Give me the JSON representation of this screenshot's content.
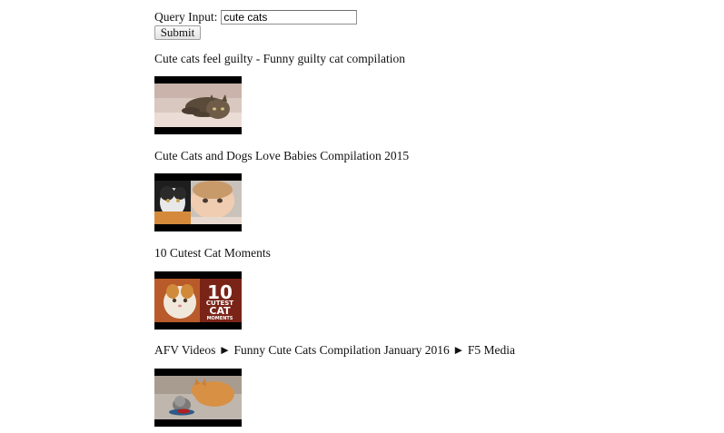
{
  "search": {
    "label": "Query Input:",
    "value": "cute cats",
    "submit_label": "Submit"
  },
  "results": [
    {
      "title": "Cute cats feel guilty - Funny guilty cat compilation"
    },
    {
      "title": "Cute Cats and Dogs Love Babies Compilation 2015"
    },
    {
      "title": "10 Cutest Cat Moments",
      "thumb_text": [
        "10",
        "CUTEST",
        "CAT",
        "MOMENTS"
      ]
    },
    {
      "title": "AFV Videos ► Funny Cute Cats Compilation January 2016 ► F5 Media"
    }
  ]
}
